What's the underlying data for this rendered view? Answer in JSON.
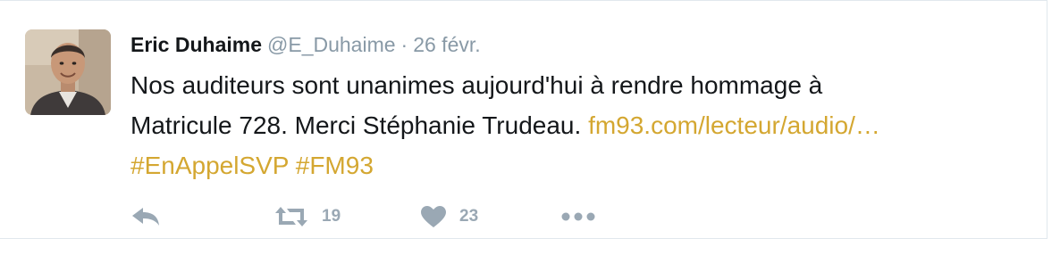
{
  "tweet": {
    "author_name": "Eric Duhaime",
    "handle": "@E_Duhaime",
    "separator": "·",
    "time": "26 févr.",
    "text_line1": "Nos auditeurs sont unanimes aujourd'hui à rendre hommage à",
    "text_line2_prefix": "Matricule 728. Merci Stéphanie Trudeau.",
    "link": "fm93.com/lecteur/audio/…",
    "hashtag1": "#EnAppelSVP",
    "hashtag2": "#FM93",
    "retweet_count": "19",
    "like_count": "23"
  },
  "icons": {
    "avatar": "avatar",
    "reply": "reply-icon",
    "retweet": "retweet-icon",
    "like": "heart-icon",
    "more": "more-icon"
  },
  "colors": {
    "link": "#d4a731",
    "muted": "#8899a6",
    "border": "#e1e8ed"
  }
}
